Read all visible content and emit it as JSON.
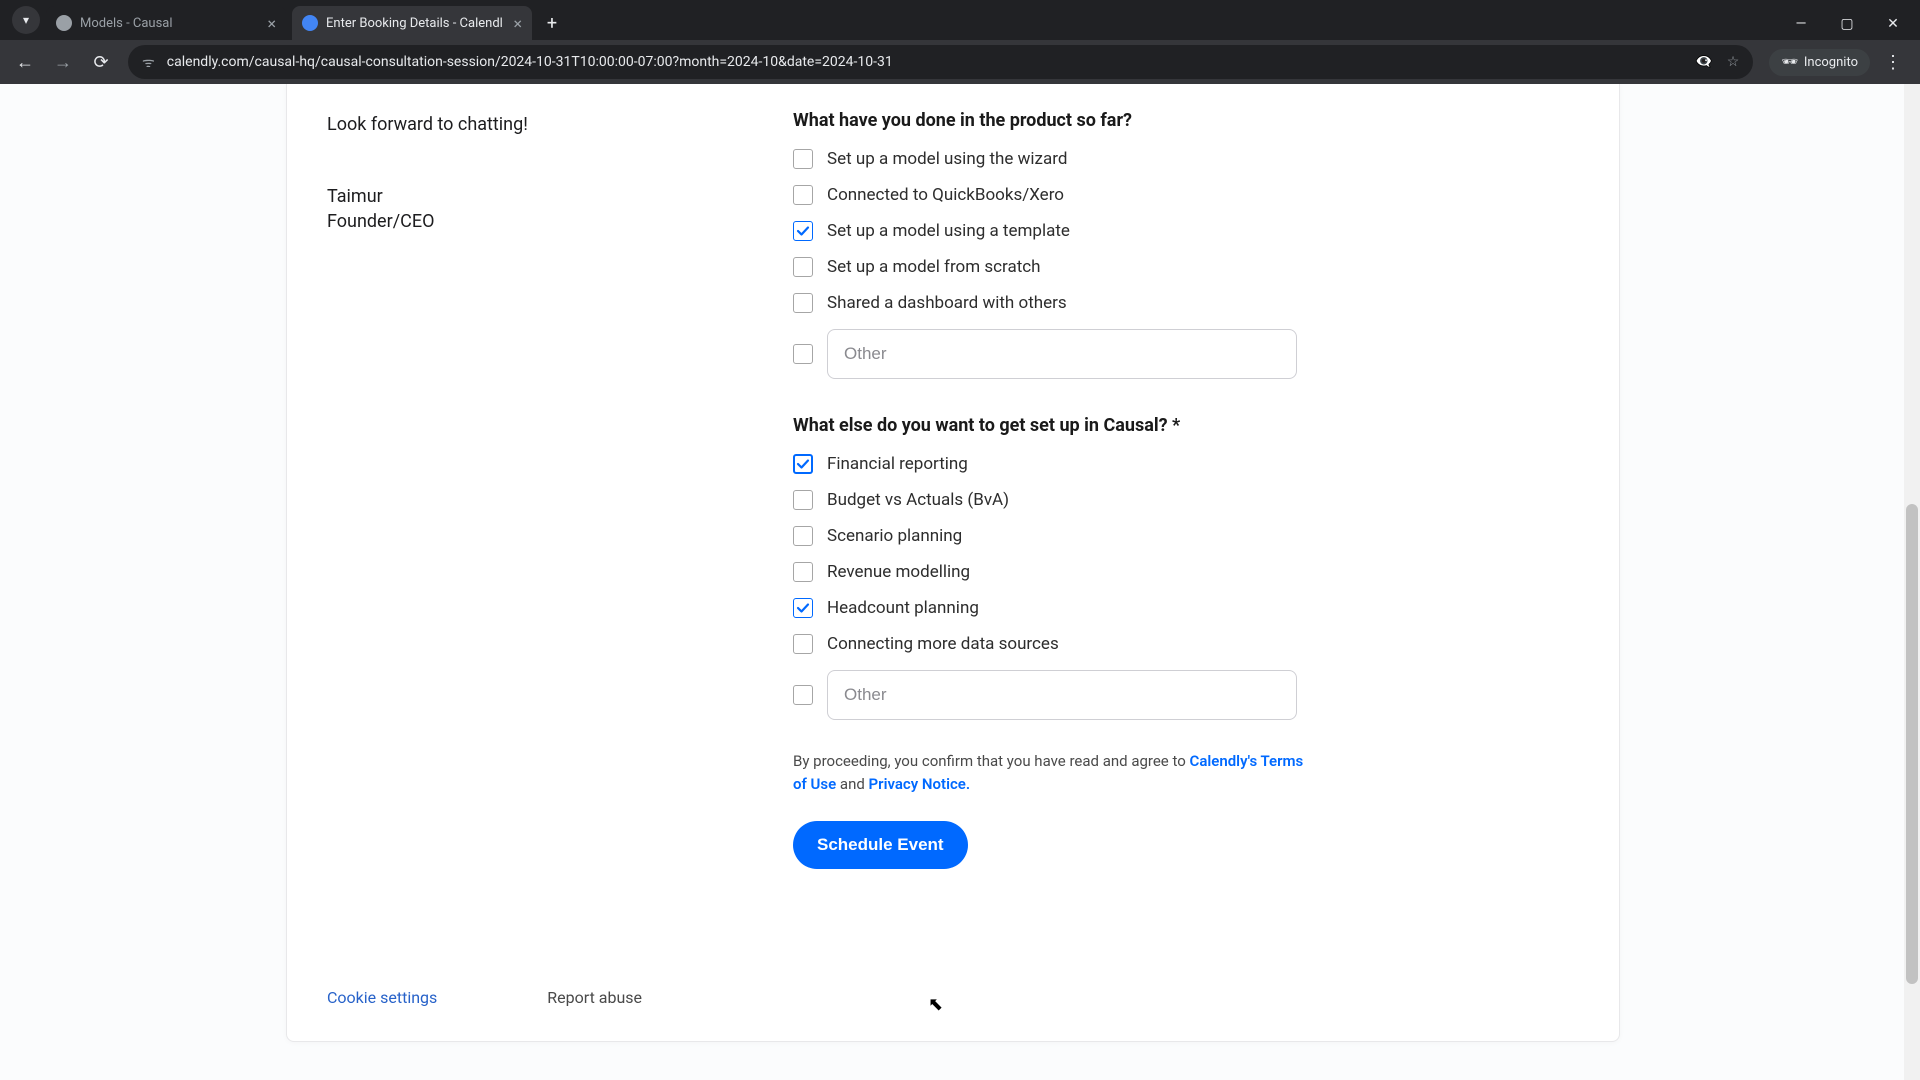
{
  "browser": {
    "tabs": [
      {
        "title": "Models - Causal"
      },
      {
        "title": "Enter Booking Details - Calendl"
      }
    ],
    "url": "calendly.com/causal-hq/causal-consultation-session/2024-10-31T10:00:00-07:00?month=2024-10&date=2024-10-31",
    "incognito_label": "Incognito"
  },
  "sidebar": {
    "intro": "Look forward to chatting!",
    "sig_name": "Taimur",
    "sig_title": "Founder/CEO",
    "cookie_link": "Cookie settings",
    "report_link": "Report abuse"
  },
  "form": {
    "q1_label": "What have you done in the product so far?",
    "q1_options": [
      {
        "label": "Set up a model using the wizard",
        "checked": false
      },
      {
        "label": "Connected to QuickBooks/Xero",
        "checked": false
      },
      {
        "label": "Set up a model using a template",
        "checked": true
      },
      {
        "label": "Set up a model from scratch",
        "checked": false
      },
      {
        "label": "Shared a dashboard with others",
        "checked": false
      }
    ],
    "q1_other_placeholder": "Other",
    "q2_label": "What else do you want to get set up in Causal? *",
    "q2_options": [
      {
        "label": "Financial reporting",
        "checked": true
      },
      {
        "label": "Budget vs Actuals (BvA)",
        "checked": false
      },
      {
        "label": "Scenario planning",
        "checked": false
      },
      {
        "label": "Revenue modelling",
        "checked": false
      },
      {
        "label": "Headcount planning",
        "checked": true
      },
      {
        "label": "Connecting more data sources",
        "checked": false
      }
    ],
    "q2_other_placeholder": "Other",
    "legal_prefix": "By proceeding, you confirm that you have read and agree to ",
    "legal_terms": "Calendly's Terms of Use",
    "legal_and": " and ",
    "legal_privacy": "Privacy Notice.",
    "submit_label": "Schedule Event"
  }
}
